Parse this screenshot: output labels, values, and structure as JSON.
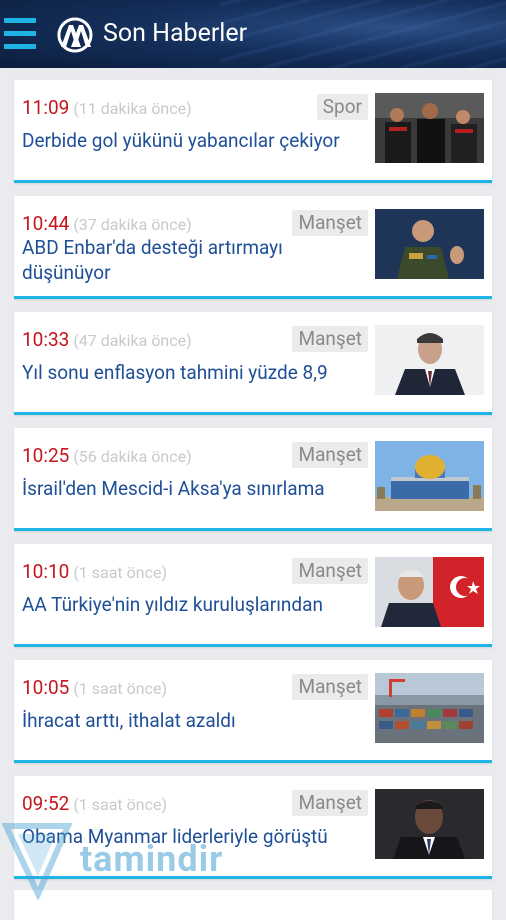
{
  "header": {
    "title": "Son Haberler"
  },
  "news": [
    {
      "time": "11:09",
      "ago": "(11 dakika önce)",
      "category": "Spor",
      "headline": [
        "Derbide gol yükünü yabancılar çekiyor"
      ],
      "image": "football-players-photo"
    },
    {
      "time": "10:44",
      "ago": "(37 dakika önce)",
      "category": "Manşet",
      "headline": [
        "ABD Enbar'da desteği artırmayı",
        "düşünüyor"
      ],
      "image": "general-speaking-photo"
    },
    {
      "time": "10:33",
      "ago": "(47 dakika önce)",
      "category": "Manşet",
      "headline": [
        "Yıl sonu enflasyon tahmini yüzde 8,9"
      ],
      "image": "official-portrait-photo"
    },
    {
      "time": "10:25",
      "ago": "(56 dakika önce)",
      "category": "Manşet",
      "headline": [
        "İsrail'den Mescid-i Aksa'ya sınırlama"
      ],
      "image": "dome-of-the-rock-photo"
    },
    {
      "time": "10:10",
      "ago": "(1 saat önce)",
      "category": "Manşet",
      "headline": [
        "AA Türkiye'nin yıldız kuruluşlarından"
      ],
      "image": "minister-with-flag-photo"
    },
    {
      "time": "10:05",
      "ago": "(1 saat önce)",
      "category": "Manşet",
      "headline": [
        "İhracat arttı, ithalat azaldı"
      ],
      "image": "container-port-photo"
    },
    {
      "time": "09:52",
      "ago": "(1 saat önce)",
      "category": "Manşet",
      "headline": [
        "Obama Myanmar liderleriyle görüştü"
      ],
      "image": "obama-portrait-photo"
    }
  ],
  "watermark": {
    "text": "tamindir"
  }
}
